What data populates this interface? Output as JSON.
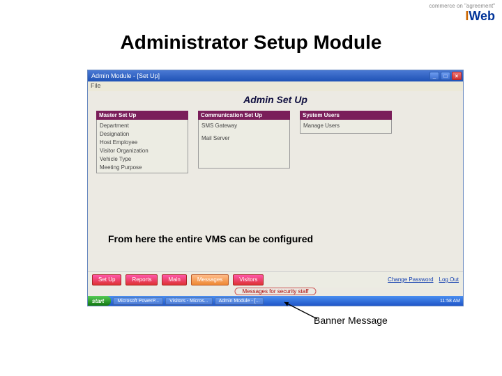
{
  "slide": {
    "title": "Administrator Setup Module",
    "caption": "From here the entire VMS can be configured",
    "annotation": "Banner Message"
  },
  "logo": {
    "tagline": "commerce on \"agreement\"",
    "brand_i": "I",
    "brand_rest": "Web"
  },
  "window": {
    "title": "Admin Module - [Set Up]",
    "minimize": "_",
    "maximize": "□",
    "close": "×",
    "menubar": "File"
  },
  "content": {
    "heading": "Admin Set Up",
    "columns": [
      {
        "title": "Master Set Up",
        "items": [
          "Department",
          "Designation",
          "Host Employee",
          "Visitor Organization",
          "Vehicle Type",
          "Meeting Purpose"
        ]
      },
      {
        "title": "Communication Set Up",
        "items": [
          "SMS Gateway",
          "Mail Server"
        ]
      },
      {
        "title": "System Users",
        "items": [
          "Manage Users"
        ]
      }
    ]
  },
  "tabs": {
    "items": [
      "Set Up",
      "Reports",
      "Main",
      "Messages",
      "Visitors"
    ],
    "links": {
      "changepw": "Change Password",
      "logout": "Log Out"
    }
  },
  "banner": {
    "text": "Messages for security staff"
  },
  "taskbar": {
    "start": "start",
    "buttons": [
      "Microsoft PowerP...",
      "Visitors - Micros...",
      "Admin Module - [..."
    ],
    "time": "11:58 AM"
  }
}
